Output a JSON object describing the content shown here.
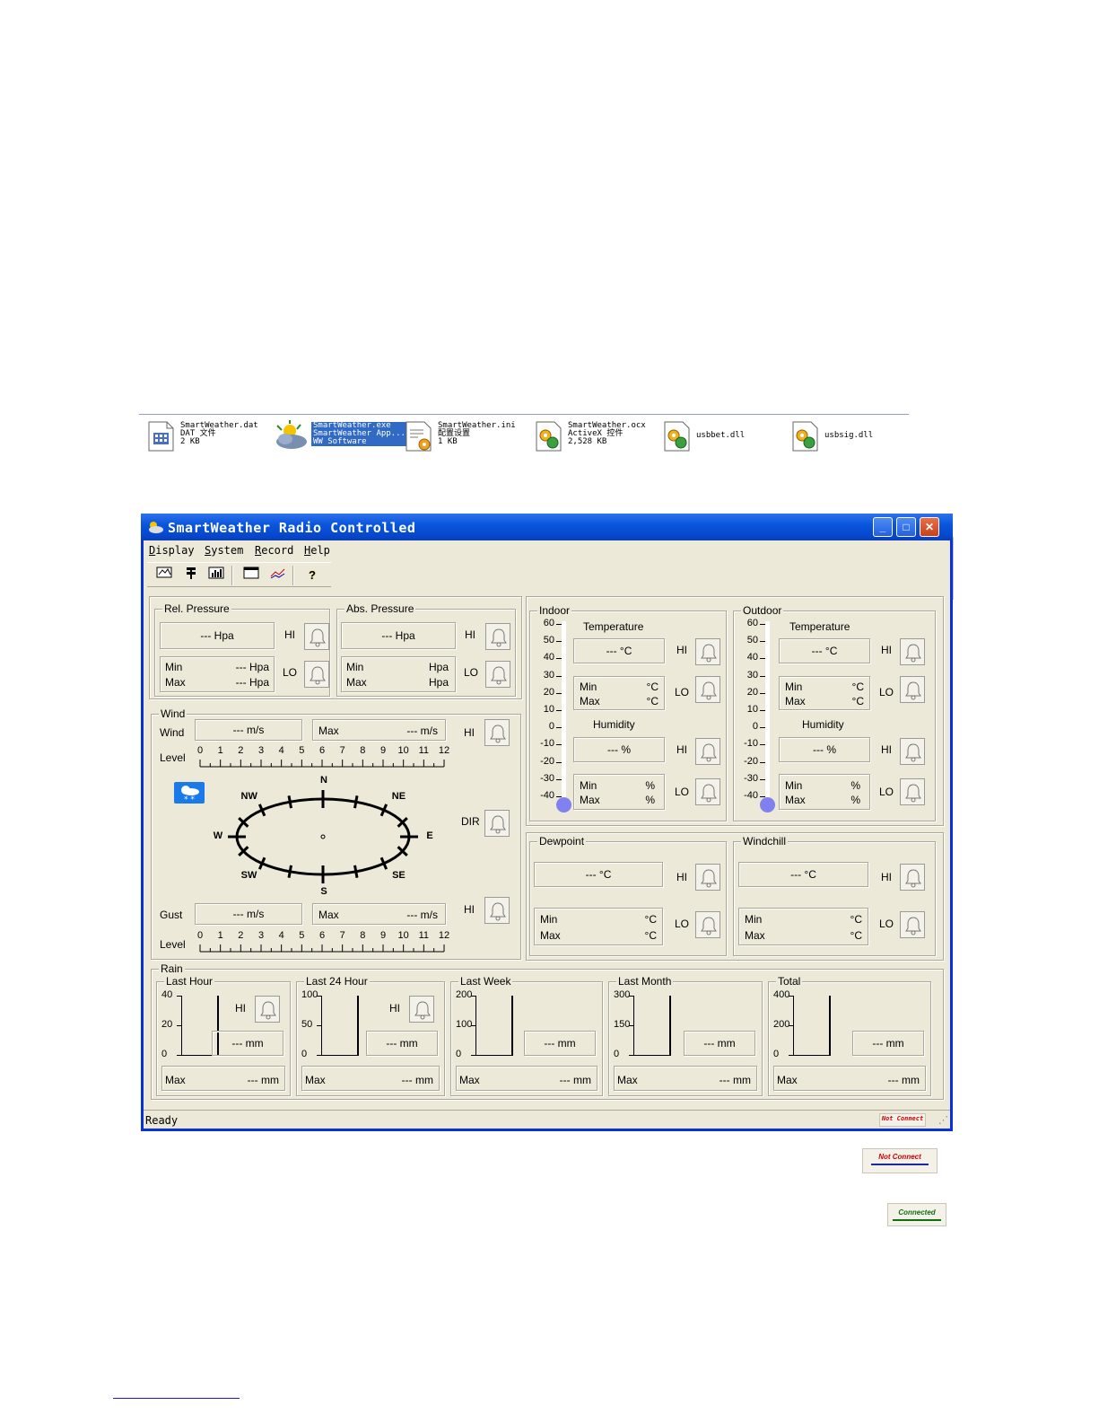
{
  "files": [
    {
      "name": "SmartWeather.dat",
      "line2": "DAT 文件",
      "line3": "2 KB",
      "icon": "dat-file-icon"
    },
    {
      "name": "SmartWeather.exe",
      "line2": "SmartWeather App...",
      "line3": "WW Software",
      "icon": "cloud-sun-app-icon",
      "selected": true
    },
    {
      "name": "SmartWeather.ini",
      "line2": "配置设置",
      "line3": "1 KB",
      "icon": "ini-settings-icon"
    },
    {
      "name": "SmartWeather.ocx",
      "line2": "ActiveX 控件",
      "line3": "2,528 KB",
      "icon": "activex-gear-icon"
    },
    {
      "name": "usbbet.dll",
      "icon": "dll-gear-icon"
    },
    {
      "name": "usbsig.dll",
      "icon": "dll-gear-icon"
    }
  ],
  "window": {
    "title": "SmartWeather Radio Controlled",
    "menu": [
      {
        "hot": "D",
        "rest": "isplay"
      },
      {
        "hot": "S",
        "rest": "ystem"
      },
      {
        "hot": "R",
        "rest": "ecord"
      },
      {
        "hot": "H",
        "rest": "elp"
      }
    ],
    "toolbar_icons": [
      "display-icon",
      "settings-icon",
      "history-chart-icon",
      "window-icon",
      "graph-icon",
      "help-icon"
    ],
    "status": "Ready",
    "status_badge": "Not Connect"
  },
  "pressure": {
    "rel": {
      "title": "Rel. Pressure",
      "value": "--- Hpa",
      "min_label": "Min",
      "min_value": "--- Hpa",
      "max_label": "Max",
      "max_value": "--- Hpa"
    },
    "abs": {
      "title": "Abs. Pressure",
      "value": "--- Hpa",
      "min_label": "Min",
      "min_unit": "Hpa",
      "max_label": "Max",
      "max_unit": "Hpa"
    },
    "hi": "HI",
    "lo": "LO"
  },
  "wind": {
    "title": "Wind",
    "wind_label": "Wind",
    "wind_value": "--- m/s",
    "max_label": "Max",
    "max_value": "--- m/s",
    "level_label": "Level",
    "levels": [
      "0",
      "1",
      "2",
      "3",
      "4",
      "5",
      "6",
      "7",
      "8",
      "9",
      "10",
      "11",
      "12"
    ],
    "compass": [
      "N",
      "NE",
      "E",
      "SE",
      "S",
      "SW",
      "W",
      "NW"
    ],
    "dir_label": "DIR",
    "gust_label": "Gust",
    "gust_value": "--- m/s",
    "gust_max_label": "Max",
    "gust_max_value": "--- m/s",
    "hi": "HI"
  },
  "thermo_scale": [
    "60",
    "50",
    "40",
    "30",
    "20",
    "10",
    "0",
    "-10",
    "-20",
    "-30",
    "-40"
  ],
  "indoor": {
    "title": "Indoor",
    "temp_label": "Temperature",
    "temp_value": "--- °C",
    "min_label": "Min",
    "max_label": "Max",
    "temp_unit": "°C",
    "hum_label": "Humidity",
    "hum_value": "--- %",
    "hum_unit": "%"
  },
  "outdoor": {
    "title": "Outdoor",
    "temp_label": "Temperature",
    "temp_value": "--- °C",
    "min_label": "Min",
    "max_label": "Max",
    "temp_unit": "°C",
    "hum_label": "Humidity",
    "hum_value": "--- %",
    "hum_unit": "%"
  },
  "dewpoint": {
    "title": "Dewpoint",
    "value": "--- °C",
    "min_label": "Min",
    "max_label": "Max",
    "unit": "°C"
  },
  "windchill": {
    "title": "Windchill",
    "value": "--- °C",
    "min_label": "Min",
    "max_label": "Max",
    "unit": "°C"
  },
  "hi_label": "HI",
  "lo_label": "LO",
  "rain": {
    "title": "Rain",
    "panels": [
      {
        "title": "Last Hour",
        "ticks": [
          "40",
          "20",
          "0"
        ],
        "value": "--- mm",
        "max_label": "Max",
        "max_value": "--- mm",
        "hi": "HI"
      },
      {
        "title": "Last 24 Hour",
        "ticks": [
          "100",
          "50",
          "0"
        ],
        "value": "--- mm",
        "max_label": "Max",
        "max_value": "--- mm",
        "hi": "HI"
      },
      {
        "title": "Last Week",
        "ticks": [
          "200",
          "100",
          "0"
        ],
        "value": "--- mm",
        "max_label": "Max",
        "max_value": "--- mm"
      },
      {
        "title": "Last Month",
        "ticks": [
          "300",
          "150",
          "0"
        ],
        "value": "--- mm",
        "max_label": "Max",
        "max_value": "--- mm"
      },
      {
        "title": "Total",
        "ticks": [
          "400",
          "200",
          "0"
        ],
        "value": "--- mm",
        "max_label": "Max",
        "max_value": "--- mm"
      }
    ]
  },
  "legend_badges": {
    "not_connect": "Not Connect",
    "connected": "Connected"
  },
  "colors": {
    "title_bar": "#0a56dd",
    "window_bg": "#ece9d8",
    "thermo_bulb": "#8080f0",
    "badge_red": "#cc0000",
    "badge_green": "#107010"
  }
}
